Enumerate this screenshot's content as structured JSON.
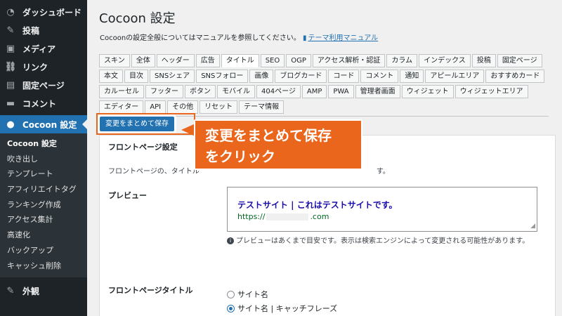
{
  "sidebar": {
    "items": [
      {
        "label": "ダッシュボード",
        "icon": "dashboard-icon",
        "glyph": "◔"
      },
      {
        "label": "投稿",
        "icon": "pushpin-icon",
        "glyph": "✎"
      },
      {
        "label": "メディア",
        "icon": "media-icon",
        "glyph": "▣"
      },
      {
        "label": "リンク",
        "icon": "link-icon",
        "glyph": "⛓"
      },
      {
        "label": "固定ページ",
        "icon": "page-icon",
        "glyph": "▤"
      },
      {
        "label": "コメント",
        "icon": "comment-icon",
        "glyph": "▬"
      }
    ],
    "active": {
      "label": "Cocoon 設定",
      "icon": "cocoon-icon",
      "glyph": "●"
    },
    "submenu": [
      "Cocoon 設定",
      "吹き出し",
      "テンプレート",
      "アフィリエイトタグ",
      "ランキング作成",
      "アクセス集計",
      "高速化",
      "バックアップ",
      "キャッシュ削除"
    ],
    "bottom": {
      "label": "外観",
      "icon": "appearance-icon",
      "glyph": "✎"
    }
  },
  "page": {
    "title": "Cocoon 設定",
    "description": "Cocoonの設定全般についてはマニュアルを参照してください。",
    "manual_link": "テーマ利用マニュアル"
  },
  "tabs": [
    "スキン",
    "全体",
    "ヘッダー",
    "広告",
    "タイトル",
    "SEO",
    "OGP",
    "アクセス解析・認証",
    "カラム",
    "インデックス",
    "投稿",
    "固定ページ",
    "本文",
    "目次",
    "SNSシェア",
    "SNSフォロー",
    "画像",
    "ブログカード",
    "コード",
    "コメント",
    "通知",
    "アピールエリア",
    "おすすめカード",
    "カルーセル",
    "フッター",
    "ボタン",
    "モバイル",
    "404ページ",
    "AMP",
    "PWA",
    "管理者画面",
    "ウィジェット",
    "ウィジェットエリア",
    "エディター",
    "API",
    "その他",
    "リセット",
    "テーマ情報"
  ],
  "active_tab": "タイトル",
  "save_button": "変更をまとめて保存",
  "panel": {
    "section_title": "フロントページ設定",
    "desc_left": "フロントページの、タイトル",
    "desc_right": "す。",
    "preview_label": "プレビュー",
    "preview_title": "テストサイト | これはテストサイトです。",
    "preview_url_prefix": "https://",
    "preview_url_suffix": ".com",
    "info_text": "プレビューはあくまで目安です。表示は検索エンジンによって変更される可能性があります。",
    "fp_title_label": "フロントページタイトル",
    "radio_options": [
      {
        "label": "サイト名",
        "checked": false
      },
      {
        "label": "サイト名 | キャッチフレーズ",
        "checked": true
      }
    ]
  },
  "callout": {
    "line1": "変更をまとめて保存",
    "line2": "をクリック",
    "color": "#e9661c"
  },
  "colors": {
    "accent": "#2271b1",
    "sidebar_bg": "#1d2327",
    "callout": "#e9661c"
  }
}
